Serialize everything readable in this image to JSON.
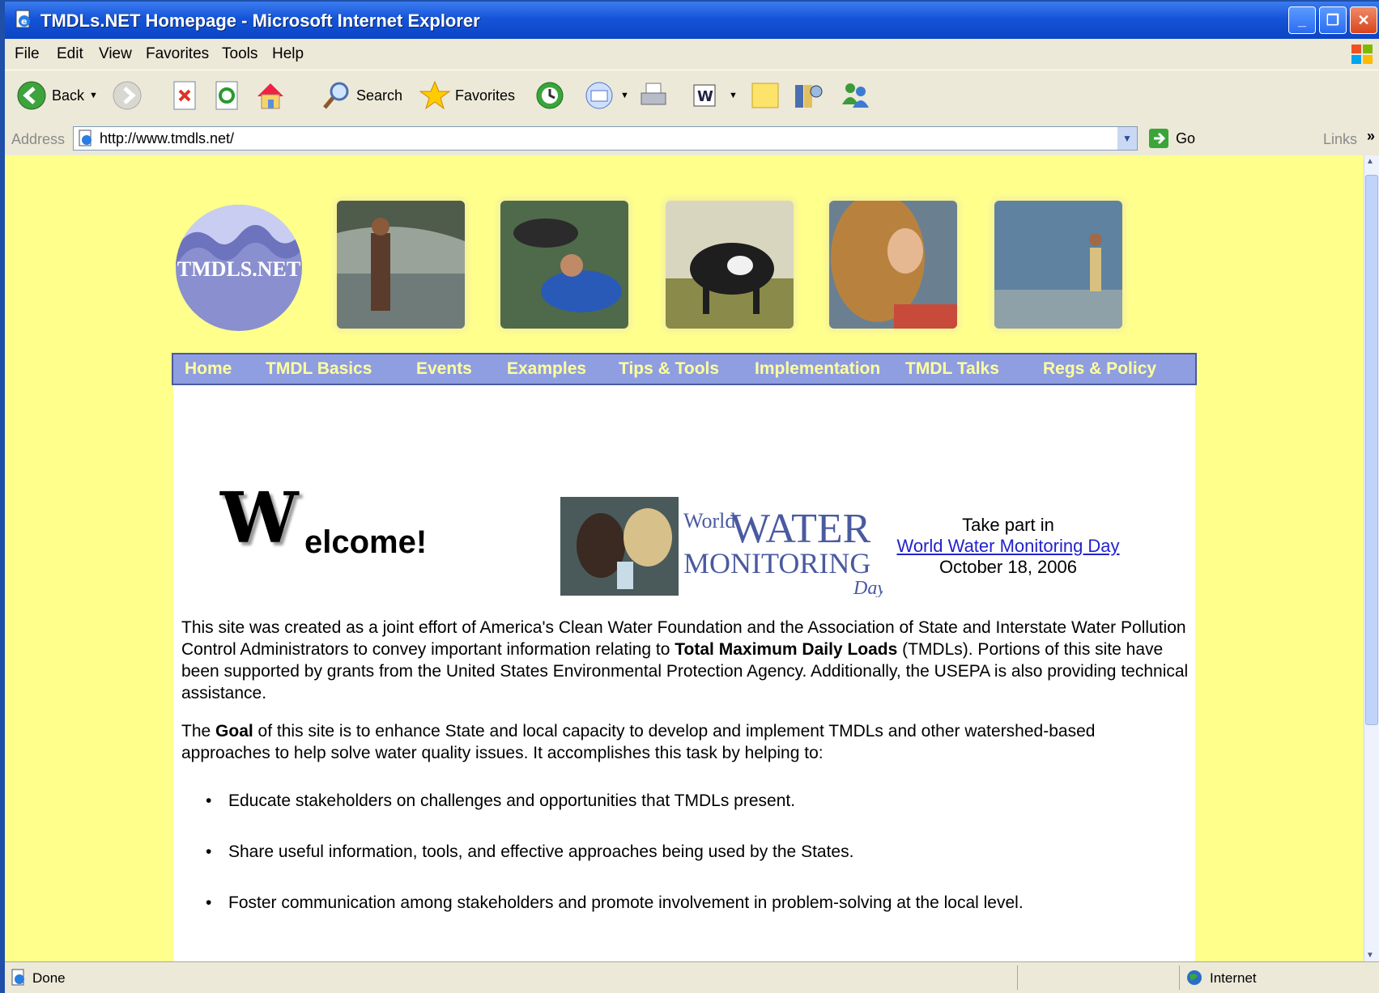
{
  "window": {
    "title": "TMDLs.NET Homepage - Microsoft Internet Explorer"
  },
  "menu": [
    "File",
    "Edit",
    "View",
    "Favorites",
    "Tools",
    "Help"
  ],
  "toolbar": {
    "back": "Back",
    "search": "Search",
    "favorites": "Favorites"
  },
  "address": {
    "label": "Address",
    "url": "http://www.tmdls.net/",
    "go": "Go",
    "links": "Links"
  },
  "status": {
    "left": "Done",
    "zone": "Internet"
  },
  "page": {
    "logo_text": "TMDLS.NET",
    "nav": [
      "Home",
      "TMDL Basics",
      "Events",
      "Examples",
      "Tips & Tools",
      "Implementation",
      "TMDL Talks",
      "Regs & Policy"
    ],
    "welcome_initial": "W",
    "welcome_rest": "elcome!",
    "wwmd": {
      "logo_small": "World",
      "logo_water": "WATER",
      "logo_monitoring": "MONITORING",
      "logo_day": "Day",
      "line1": "Take part in",
      "link": "World Water Monitoring Day",
      "date": "October 18, 2006"
    },
    "intro_part1": "This site was created as a joint effort of America's Clean Water Foundation and the Association of State and Interstate Water Pollution Control Administrators to convey important information relating to ",
    "intro_bold": "Total Maximum Daily Loads",
    "intro_part2": " (TMDLs). Portions of this site have been supported by grants from the United States Environmental Protection Agency. Additionally, the USEPA is also providing technical assistance.",
    "goal_pre": "The ",
    "goal_bold": "Goal",
    "goal_post": " of this site is to enhance State and local capacity to develop and implement TMDLs and other watershed-based approaches to help solve water quality issues. It accomplishes this task by helping to:",
    "bullets": [
      "Educate stakeholders on challenges and opportunities that TMDLs present.",
      "Share useful information, tools, and effective approaches being used by the States.",
      "Foster communication among stakeholders and promote involvement in problem-solving at the local level."
    ]
  }
}
